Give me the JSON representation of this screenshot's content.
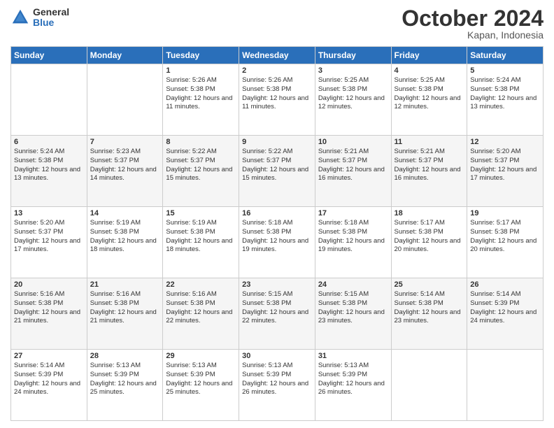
{
  "header": {
    "logo": {
      "general": "General",
      "blue": "Blue"
    },
    "title": "October 2024",
    "location": "Kapan, Indonesia"
  },
  "days_of_week": [
    "Sunday",
    "Monday",
    "Tuesday",
    "Wednesday",
    "Thursday",
    "Friday",
    "Saturday"
  ],
  "weeks": [
    [
      {
        "day": "",
        "info": ""
      },
      {
        "day": "",
        "info": ""
      },
      {
        "day": "1",
        "info": "Sunrise: 5:26 AM\nSunset: 5:38 PM\nDaylight: 12 hours and 11 minutes."
      },
      {
        "day": "2",
        "info": "Sunrise: 5:26 AM\nSunset: 5:38 PM\nDaylight: 12 hours and 11 minutes."
      },
      {
        "day": "3",
        "info": "Sunrise: 5:25 AM\nSunset: 5:38 PM\nDaylight: 12 hours and 12 minutes."
      },
      {
        "day": "4",
        "info": "Sunrise: 5:25 AM\nSunset: 5:38 PM\nDaylight: 12 hours and 12 minutes."
      },
      {
        "day": "5",
        "info": "Sunrise: 5:24 AM\nSunset: 5:38 PM\nDaylight: 12 hours and 13 minutes."
      }
    ],
    [
      {
        "day": "6",
        "info": "Sunrise: 5:24 AM\nSunset: 5:38 PM\nDaylight: 12 hours and 13 minutes."
      },
      {
        "day": "7",
        "info": "Sunrise: 5:23 AM\nSunset: 5:37 PM\nDaylight: 12 hours and 14 minutes."
      },
      {
        "day": "8",
        "info": "Sunrise: 5:22 AM\nSunset: 5:37 PM\nDaylight: 12 hours and 15 minutes."
      },
      {
        "day": "9",
        "info": "Sunrise: 5:22 AM\nSunset: 5:37 PM\nDaylight: 12 hours and 15 minutes."
      },
      {
        "day": "10",
        "info": "Sunrise: 5:21 AM\nSunset: 5:37 PM\nDaylight: 12 hours and 16 minutes."
      },
      {
        "day": "11",
        "info": "Sunrise: 5:21 AM\nSunset: 5:37 PM\nDaylight: 12 hours and 16 minutes."
      },
      {
        "day": "12",
        "info": "Sunrise: 5:20 AM\nSunset: 5:37 PM\nDaylight: 12 hours and 17 minutes."
      }
    ],
    [
      {
        "day": "13",
        "info": "Sunrise: 5:20 AM\nSunset: 5:37 PM\nDaylight: 12 hours and 17 minutes."
      },
      {
        "day": "14",
        "info": "Sunrise: 5:19 AM\nSunset: 5:38 PM\nDaylight: 12 hours and 18 minutes."
      },
      {
        "day": "15",
        "info": "Sunrise: 5:19 AM\nSunset: 5:38 PM\nDaylight: 12 hours and 18 minutes."
      },
      {
        "day": "16",
        "info": "Sunrise: 5:18 AM\nSunset: 5:38 PM\nDaylight: 12 hours and 19 minutes."
      },
      {
        "day": "17",
        "info": "Sunrise: 5:18 AM\nSunset: 5:38 PM\nDaylight: 12 hours and 19 minutes."
      },
      {
        "day": "18",
        "info": "Sunrise: 5:17 AM\nSunset: 5:38 PM\nDaylight: 12 hours and 20 minutes."
      },
      {
        "day": "19",
        "info": "Sunrise: 5:17 AM\nSunset: 5:38 PM\nDaylight: 12 hours and 20 minutes."
      }
    ],
    [
      {
        "day": "20",
        "info": "Sunrise: 5:16 AM\nSunset: 5:38 PM\nDaylight: 12 hours and 21 minutes."
      },
      {
        "day": "21",
        "info": "Sunrise: 5:16 AM\nSunset: 5:38 PM\nDaylight: 12 hours and 21 minutes."
      },
      {
        "day": "22",
        "info": "Sunrise: 5:16 AM\nSunset: 5:38 PM\nDaylight: 12 hours and 22 minutes."
      },
      {
        "day": "23",
        "info": "Sunrise: 5:15 AM\nSunset: 5:38 PM\nDaylight: 12 hours and 22 minutes."
      },
      {
        "day": "24",
        "info": "Sunrise: 5:15 AM\nSunset: 5:38 PM\nDaylight: 12 hours and 23 minutes."
      },
      {
        "day": "25",
        "info": "Sunrise: 5:14 AM\nSunset: 5:38 PM\nDaylight: 12 hours and 23 minutes."
      },
      {
        "day": "26",
        "info": "Sunrise: 5:14 AM\nSunset: 5:39 PM\nDaylight: 12 hours and 24 minutes."
      }
    ],
    [
      {
        "day": "27",
        "info": "Sunrise: 5:14 AM\nSunset: 5:39 PM\nDaylight: 12 hours and 24 minutes."
      },
      {
        "day": "28",
        "info": "Sunrise: 5:13 AM\nSunset: 5:39 PM\nDaylight: 12 hours and 25 minutes."
      },
      {
        "day": "29",
        "info": "Sunrise: 5:13 AM\nSunset: 5:39 PM\nDaylight: 12 hours and 25 minutes."
      },
      {
        "day": "30",
        "info": "Sunrise: 5:13 AM\nSunset: 5:39 PM\nDaylight: 12 hours and 26 minutes."
      },
      {
        "day": "31",
        "info": "Sunrise: 5:13 AM\nSunset: 5:39 PM\nDaylight: 12 hours and 26 minutes."
      },
      {
        "day": "",
        "info": ""
      },
      {
        "day": "",
        "info": ""
      }
    ]
  ]
}
